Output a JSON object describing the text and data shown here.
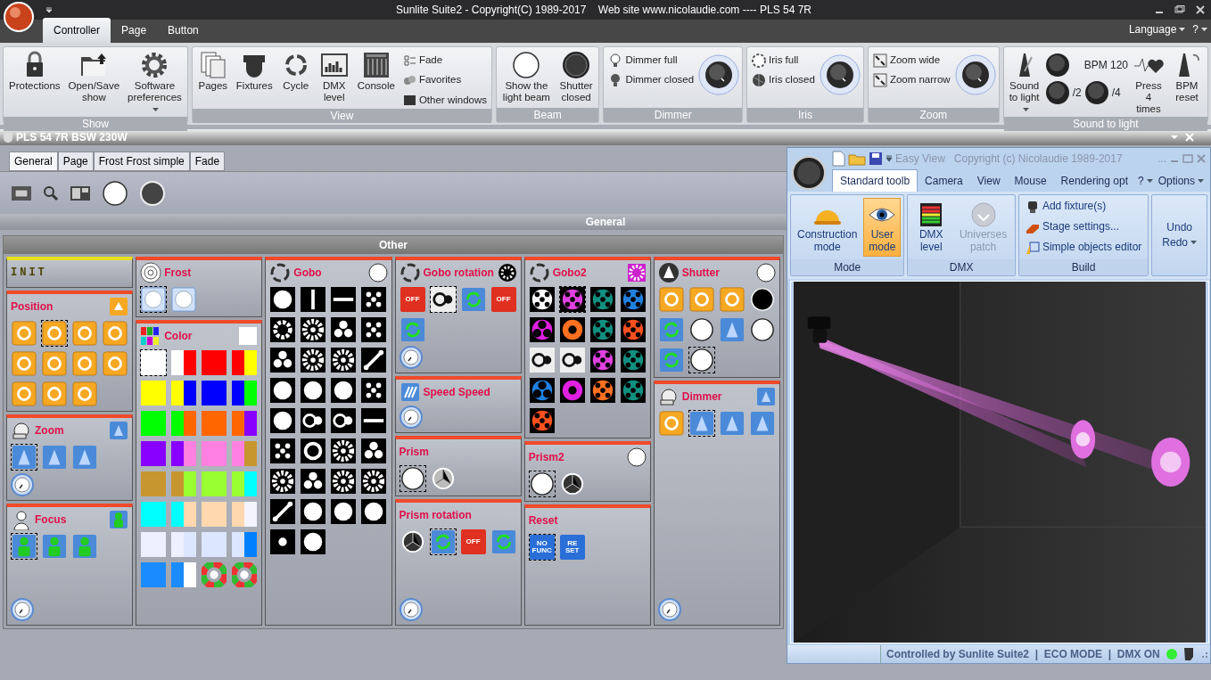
{
  "window": {
    "title": "Sunlite Suite2 - Copyright(C) 1989-2017    Web site www.nicolaudie.com ---- PLS 54 7R"
  },
  "app_tabs": [
    {
      "label": "Controller",
      "selected": true
    },
    {
      "label": "Page",
      "selected": false
    },
    {
      "label": "Button",
      "selected": false
    }
  ],
  "menu_right": [
    {
      "label": "Language"
    },
    {
      "label": "?"
    }
  ],
  "ribbon_groups": [
    {
      "title": "Show",
      "items": [
        {
          "kind": "large",
          "label": "Protections"
        },
        {
          "kind": "large",
          "label": "Open/Save show"
        },
        {
          "kind": "large",
          "label": "Software preferences",
          "dropdown": true
        }
      ]
    },
    {
      "title": "View",
      "items": [
        {
          "kind": "large",
          "label": "Pages"
        },
        {
          "kind": "large",
          "label": "Fixtures"
        },
        {
          "kind": "large",
          "label": "Cycle"
        },
        {
          "kind": "large",
          "label": "DMX level"
        },
        {
          "kind": "large",
          "label": "Console"
        },
        {
          "kind": "smalls",
          "entries": [
            "Fade",
            "Favorites",
            "Other windows"
          ]
        }
      ]
    },
    {
      "title": "Beam",
      "items": [
        {
          "kind": "large",
          "label": "Show the light beam"
        },
        {
          "kind": "large",
          "label": "Shutter closed"
        }
      ]
    },
    {
      "title": "Dimmer",
      "items": [
        {
          "kind": "smalls",
          "entries": [
            "Dimmer full",
            "Dimmer closed"
          ]
        },
        {
          "kind": "knob"
        }
      ]
    },
    {
      "title": "Iris",
      "items": [
        {
          "kind": "smalls",
          "entries": [
            "Iris full",
            "Iris closed"
          ]
        },
        {
          "kind": "knob"
        }
      ]
    },
    {
      "title": "Zoom",
      "items": [
        {
          "kind": "smalls",
          "entries": [
            "Zoom wide",
            "Zoom narrow"
          ]
        },
        {
          "kind": "knob"
        }
      ]
    },
    {
      "title": "Sound to light",
      "items": [
        {
          "kind": "large",
          "label": "Sound to light",
          "dropdown": true
        },
        {
          "kind": "bpm",
          "reading": "BPM 120",
          "dividers": [
            "/2",
            "/4"
          ]
        },
        {
          "kind": "large",
          "label": "Press 4 times"
        },
        {
          "kind": "large",
          "label": "BPM reset"
        }
      ]
    }
  ],
  "fixture_window": {
    "title": "PLS 54 7R BSW 230W",
    "tabs": [
      {
        "label": "General",
        "selected": true
      },
      {
        "label": "Page",
        "selected": false
      },
      {
        "label": "Frost Frost simple",
        "selected": false
      },
      {
        "label": "Fade",
        "selected": false
      }
    ],
    "section": "General",
    "group": "Other"
  },
  "panel_columns": [
    [
      {
        "kind": "init",
        "title": "INIT"
      },
      {
        "title": "Position",
        "items": [
          {
            "kind": "orange",
            "selected": false
          },
          {
            "kind": "orange",
            "selected": true
          },
          {
            "kind": "orange",
            "selected": false
          },
          {
            "kind": "orange",
            "selected": false
          },
          {
            "kind": "orange",
            "selected": false
          },
          {
            "kind": "orange",
            "selected": false
          },
          {
            "kind": "orange",
            "selected": false
          },
          {
            "kind": "orange",
            "selected": false
          },
          {
            "kind": "orange",
            "selected": false
          },
          {
            "kind": "orange",
            "selected": false
          },
          {
            "kind": "orange",
            "selected": false
          }
        ]
      },
      {
        "title": "Zoom",
        "dial": true,
        "items": [
          {
            "kind": "blue",
            "selected": true
          },
          {
            "kind": "blue",
            "selected": false
          },
          {
            "kind": "blue",
            "selected": false
          }
        ]
      },
      {
        "title": "Focus",
        "dial": true,
        "items": [
          {
            "kind": "figure",
            "selected": true
          },
          {
            "kind": "figure",
            "selected": false
          },
          {
            "kind": "figure",
            "selected": false
          }
        ]
      }
    ],
    [
      {
        "title": "Frost",
        "items": [
          {
            "kind": "spot",
            "selected": true
          },
          {
            "kind": "spot",
            "selected": false
          }
        ]
      },
      {
        "title": "Color",
        "items": [
          {
            "kind": "color",
            "color": "#ffffff",
            "selected": true
          },
          {
            "kind": "color",
            "halves": [
              {
                "color": "#ffffff"
              },
              {
                "color": "#ff0000"
              }
            ],
            "selected": false
          },
          {
            "kind": "color",
            "color": "#ff0000",
            "selected": false
          },
          {
            "kind": "color",
            "halves": [
              {
                "color": "#ff0000"
              },
              {
                "color": "#ffff00"
              }
            ],
            "selected": false
          },
          {
            "kind": "color",
            "color": "#ffff00",
            "selected": false
          },
          {
            "kind": "color",
            "halves": [
              {
                "color": "#ffff00"
              },
              {
                "color": "#0000ff"
              }
            ],
            "selected": false
          },
          {
            "kind": "color",
            "color": "#0000ff",
            "selected": false
          },
          {
            "kind": "color",
            "halves": [
              {
                "color": "#0000ff"
              },
              {
                "color": "#00ff00"
              }
            ],
            "selected": false
          },
          {
            "kind": "color",
            "color": "#00ff00",
            "selected": false
          },
          {
            "kind": "color",
            "halves": [
              {
                "color": "#00ff00"
              },
              {
                "color": "#ff6600"
              }
            ],
            "selected": false
          },
          {
            "kind": "color",
            "color": "#ff6600",
            "selected": false
          },
          {
            "kind": "color",
            "halves": [
              {
                "color": "#ff6600"
              },
              {
                "color": "#8800ff"
              }
            ],
            "selected": false
          },
          {
            "kind": "color",
            "color": "#8800ff",
            "selected": false
          },
          {
            "kind": "color",
            "halves": [
              {
                "color": "#8800ff"
              },
              {
                "color": "#ff80e0"
              }
            ],
            "selected": false
          },
          {
            "kind": "color",
            "color": "#ff80e0",
            "selected": false
          },
          {
            "kind": "color",
            "halves": [
              {
                "color": "#ff80e0"
              },
              {
                "color": "#c8962f"
              }
            ],
            "selected": false
          },
          {
            "kind": "color",
            "color": "#c8962f",
            "selected": false
          },
          {
            "kind": "color",
            "halves": [
              {
                "color": "#c8962f"
              },
              {
                "color": "#99ff33"
              }
            ],
            "selected": false
          },
          {
            "kind": "color",
            "color": "#99ff33",
            "selected": false
          },
          {
            "kind": "color",
            "halves": [
              {
                "color": "#99ff33"
              },
              {
                "color": "#00ffff"
              }
            ],
            "selected": false
          },
          {
            "kind": "color",
            "color": "#00ffff",
            "selected": false
          },
          {
            "kind": "color",
            "halves": [
              {
                "color": "#00ffff"
              },
              {
                "color": "#ffd8b0"
              }
            ],
            "selected": false
          },
          {
            "kind": "color",
            "color": "#ffd8b0",
            "selected": false
          },
          {
            "kind": "color",
            "halves": [
              {
                "color": "#ffd8b0"
              },
              {
                "color": "#f4f4ff"
              }
            ],
            "selected": false
          },
          {
            "kind": "color",
            "color": "#eef0ff",
            "selected": false
          },
          {
            "kind": "color",
            "halves": [
              {
                "color": "#eef0ff"
              },
              {
                "color": "#dde6ff"
              }
            ],
            "selected": false
          },
          {
            "kind": "color",
            "color": "#dde6ff",
            "selected": false
          },
          {
            "kind": "color",
            "halves": [
              {
                "color": "#dde6ff"
              },
              {
                "color": "#0080ff"
              }
            ],
            "selected": false
          },
          {
            "kind": "color",
            "color": "#1a8cff",
            "selected": false
          },
          {
            "kind": "color",
            "halves": [
              {
                "color": "#1a8cff"
              },
              {
                "color": "#ffffff"
              }
            ],
            "selected": false
          },
          {
            "kind": "wheel",
            "selected": false
          },
          {
            "kind": "wheel",
            "selected": false
          }
        ]
      }
    ],
    [
      {
        "title": "Gobo",
        "items": [
          {
            "kind": "gobo",
            "selected": false
          },
          {
            "kind": "gobo",
            "selected": false
          },
          {
            "kind": "gobo",
            "selected": false
          },
          {
            "kind": "gobo",
            "selected": false
          },
          {
            "kind": "gobo",
            "selected": false
          },
          {
            "kind": "gobo",
            "selected": false
          },
          {
            "kind": "gobo",
            "selected": false
          },
          {
            "kind": "gobo",
            "selected": false
          },
          {
            "kind": "gobo",
            "selected": false
          },
          {
            "kind": "gobo",
            "selected": false
          },
          {
            "kind": "gobo",
            "selected": false
          },
          {
            "kind": "gobo",
            "selected": false
          },
          {
            "kind": "gobo",
            "selected": false
          },
          {
            "kind": "gobo",
            "selected": false
          },
          {
            "kind": "gobo",
            "selected": false
          },
          {
            "kind": "gobo",
            "selected": false
          },
          {
            "kind": "gobo",
            "selected": false
          },
          {
            "kind": "gobo",
            "selected": false
          },
          {
            "kind": "gobo",
            "selected": false
          },
          {
            "kind": "gobo",
            "selected": false
          },
          {
            "kind": "gobo",
            "selected": false
          },
          {
            "kind": "gobo",
            "selected": false
          },
          {
            "kind": "gobo",
            "selected": false
          },
          {
            "kind": "gobo",
            "selected": false
          },
          {
            "kind": "gobo",
            "selected": false
          },
          {
            "kind": "gobo",
            "selected": false
          },
          {
            "kind": "gobo",
            "selected": false
          },
          {
            "kind": "gobo",
            "selected": false
          },
          {
            "kind": "gobo",
            "selected": false
          },
          {
            "kind": "gobo",
            "selected": false
          },
          {
            "kind": "gobo",
            "selected": false
          },
          {
            "kind": "gobo",
            "selected": false
          },
          {
            "kind": "gobo",
            "selected": false
          },
          {
            "kind": "gobo",
            "selected": false
          }
        ]
      }
    ],
    [
      {
        "title": "Gobo rotation",
        "dial": true,
        "items": [
          {
            "kind": "off",
            "label": "OFF",
            "selected": false
          },
          {
            "kind": "spin",
            "selected": true
          },
          {
            "kind": "arrows",
            "selected": false
          },
          {
            "kind": "off",
            "label": "OFF",
            "selected": false
          },
          {
            "kind": "arrows",
            "selected": false
          }
        ]
      },
      {
        "title": "Speed Speed",
        "dial": true
      },
      {
        "title": "Prism",
        "items": [
          {
            "kind": "white-circle",
            "selected": true
          },
          {
            "kind": "prism",
            "selected": false
          }
        ]
      },
      {
        "title": "Prism rotation",
        "dial": true,
        "items": [
          {
            "kind": "prism-dark",
            "selected": false
          },
          {
            "kind": "arrows",
            "selected": true
          },
          {
            "kind": "off",
            "label": "OFF",
            "selected": false
          },
          {
            "kind": "arrows",
            "selected": false
          }
        ]
      }
    ],
    [
      {
        "title": "Gobo2",
        "items": [
          {
            "kind": "gobo-color",
            "color": "#ffffff",
            "selected": false
          },
          {
            "kind": "gobo-color",
            "color": "#e040e0",
            "selected": true
          },
          {
            "kind": "gobo-color",
            "color": "#109080",
            "selected": false
          },
          {
            "kind": "gobo-color",
            "color": "#2080e0",
            "selected": false
          },
          {
            "kind": "gobo-color",
            "color": "#e020e0",
            "selected": false
          },
          {
            "kind": "gobo-color",
            "color": "#ff7020",
            "selected": false
          },
          {
            "kind": "gobo-color",
            "color": "#109080",
            "selected": false
          },
          {
            "kind": "gobo-color",
            "color": "#ff5020",
            "selected": false
          },
          {
            "kind": "spin",
            "selected": false
          },
          {
            "kind": "spin",
            "selected": false
          },
          {
            "kind": "gobo-color",
            "color": "#e040e0",
            "selected": false
          },
          {
            "kind": "gobo-color",
            "color": "#109080",
            "selected": false
          },
          {
            "kind": "gobo-color",
            "color": "#2080e0",
            "selected": false
          },
          {
            "kind": "gobo-color",
            "color": "#e020e0",
            "selected": false
          },
          {
            "kind": "gobo-color",
            "color": "#ff7020",
            "selected": false
          },
          {
            "kind": "gobo-color",
            "color": "#109080",
            "selected": false
          },
          {
            "kind": "gobo-color",
            "color": "#ff5020",
            "selected": false
          }
        ]
      },
      {
        "title": "Prism2",
        "items": [
          {
            "kind": "white-circle",
            "selected": true
          },
          {
            "kind": "prism-dark",
            "selected": false
          }
        ]
      },
      {
        "title": "Reset",
        "items": [
          {
            "kind": "tag",
            "label": "NO FUNC",
            "selected": true
          },
          {
            "kind": "tag",
            "label": "RE SET",
            "selected": false
          }
        ]
      }
    ],
    [
      {
        "title": "Shutter",
        "items": [
          {
            "kind": "orange",
            "selected": false
          },
          {
            "kind": "orange",
            "selected": false
          },
          {
            "kind": "orange",
            "selected": false
          },
          {
            "kind": "black-circle",
            "selected": false
          },
          {
            "kind": "arrows",
            "selected": false
          },
          {
            "kind": "white-circle",
            "selected": false
          },
          {
            "kind": "blue",
            "selected": false
          },
          {
            "kind": "white-circle",
            "selected": false
          },
          {
            "kind": "arrows",
            "selected": false
          },
          {
            "kind": "white-circle",
            "selected": true
          }
        ]
      },
      {
        "title": "Dimmer",
        "dial": true,
        "items": [
          {
            "kind": "orange",
            "selected": false
          },
          {
            "kind": "blue",
            "selected": true
          },
          {
            "kind": "blue",
            "selected": false
          },
          {
            "kind": "blue",
            "selected": false
          }
        ]
      }
    ]
  ],
  "easy_view": {
    "title": "Easy View   Copyright (c) Nicolaudie 1989-2017",
    "ellipsis": "...",
    "tabs": [
      {
        "label": "Standard toolb",
        "selected": true
      },
      {
        "label": "Camera",
        "selected": false
      },
      {
        "label": "View",
        "selected": false
      },
      {
        "label": "Mouse",
        "selected": false
      },
      {
        "label": "Rendering opt",
        "selected": false
      }
    ],
    "menu_right": [
      {
        "label": "?"
      },
      {
        "label": "Options"
      }
    ],
    "groups": [
      {
        "title": "Mode",
        "items": [
          {
            "kind": "large",
            "label": "Construction mode",
            "selected": false
          },
          {
            "kind": "large",
            "label": "User mode",
            "selected": true
          }
        ]
      },
      {
        "title": "DMX",
        "items": [
          {
            "kind": "large",
            "label": "DMX level",
            "disabled": false
          },
          {
            "kind": "large",
            "label": "Universes patch",
            "disabled": true
          }
        ]
      },
      {
        "title": "Build",
        "items": [
          {
            "kind": "small",
            "label": "Add fixture(s)"
          },
          {
            "kind": "small",
            "label": "Stage settings..."
          },
          {
            "kind": "small",
            "label": "Simple objects editor"
          }
        ]
      },
      {
        "items": [
          {
            "kind": "undo",
            "label": "Undo"
          },
          {
            "kind": "undo",
            "label": "Redo",
            "dropdown": true
          }
        ]
      }
    ],
    "status": "Controlled by Sunlite Suite2  |  ECO MODE  |  DMX ON"
  }
}
